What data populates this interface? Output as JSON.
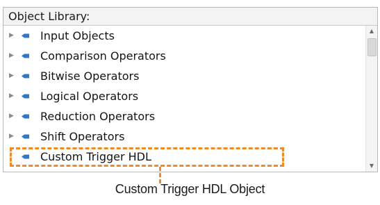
{
  "panel": {
    "title": "Object Library:",
    "items": [
      {
        "label": "Input Objects",
        "expandable": true
      },
      {
        "label": "Comparison Operators",
        "expandable": true
      },
      {
        "label": "Bitwise Operators",
        "expandable": true
      },
      {
        "label": "Logical Operators",
        "expandable": true
      },
      {
        "label": "Reduction Operators",
        "expandable": true
      },
      {
        "label": "Shift Operators",
        "expandable": true
      },
      {
        "label": "Custom Trigger HDL",
        "expandable": false
      }
    ],
    "expander_icon": "chevron-right-icon",
    "item_icon": "object-bullet-icon"
  },
  "callout": {
    "text": "Custom Trigger HDL Object"
  },
  "colors": {
    "accent": "#ef8a2a",
    "bullet": "#2f77c8"
  }
}
